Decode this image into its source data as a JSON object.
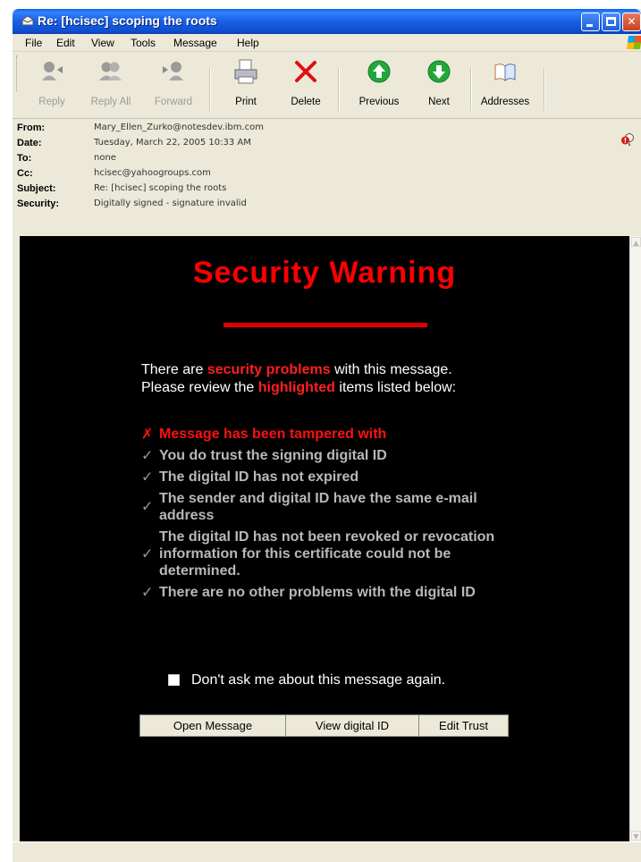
{
  "window": {
    "title": "Re: [hcisec] scoping the roots"
  },
  "menu": [
    "File",
    "Edit",
    "View",
    "Tools",
    "Message",
    "Help"
  ],
  "toolbar": {
    "reply": "Reply",
    "reply_all": "Reply All",
    "forward": "Forward",
    "print": "Print",
    "delete": "Delete",
    "previous": "Previous",
    "next": "Next",
    "addresses": "Addresses"
  },
  "headers": {
    "from_label": "From:",
    "from": "Mary_Ellen_Zurko@notesdev.ibm.com",
    "date_label": "Date:",
    "date": "Tuesday, March 22, 2005 10:33 AM",
    "to_label": "To:",
    "to": "none",
    "cc_label": "Cc:",
    "cc": "hcisec@yahoogroups.com",
    "subject_label": "Subject:",
    "subject": "Re: [hcisec] scoping the roots",
    "security_label": "Security:",
    "security": "Digitally signed - signature invalid"
  },
  "warning": {
    "title": "Security Warning",
    "intro1_a": "There are ",
    "intro1_hi": "security problems",
    "intro1_b": " with this message.",
    "intro2_a": "Please review the ",
    "intro2_hi": "highlighted",
    "intro2_b": " items listed below:",
    "items": [
      {
        "status": "fail",
        "text": "Message has been tampered with"
      },
      {
        "status": "pass",
        "text": "You do trust the signing digital ID"
      },
      {
        "status": "pass",
        "text": "The digital ID has not expired"
      },
      {
        "status": "pass",
        "text": "The sender and digital ID have the same e-mail address"
      },
      {
        "status": "pass",
        "text": "The digital ID has not been revoked or revocation information for this certificate could not be determined."
      },
      {
        "status": "pass",
        "text": "There are no other problems with the digital ID"
      }
    ],
    "dont_ask": "Don't ask me about this message again.",
    "dont_ask_checked": false,
    "buttons": {
      "open": "Open Message",
      "view": "View digital ID",
      "edit": "Edit Trust"
    }
  },
  "colors": {
    "warning_red": "#ff0000",
    "pass_gray": "#b8b8b8",
    "content_bg": "#000000",
    "titlebar_blue": "#0a5fe6"
  }
}
